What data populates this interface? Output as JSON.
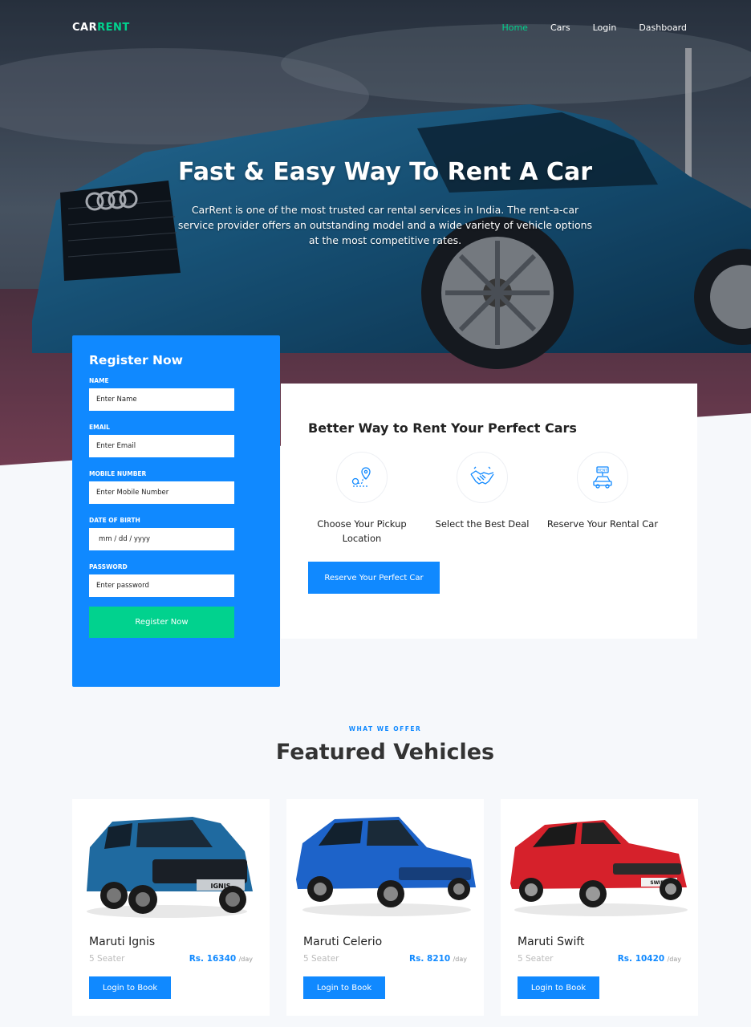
{
  "nav": {
    "logo_main": "CAR",
    "logo_accent": "RENT",
    "links": [
      "Home",
      "Cars",
      "Login",
      "Dashboard"
    ]
  },
  "hero": {
    "title": "Fast & Easy Way To Rent A Car",
    "text": "CarRent is one of the most trusted car rental services in India. The rent-a-car service provider offers an outstanding model and a wide variety of vehicle options at the most competitive rates."
  },
  "register": {
    "title": "Register Now",
    "fields": [
      {
        "label": "NAME",
        "placeholder": "Enter Name"
      },
      {
        "label": "EMAIL",
        "placeholder": "Enter Email"
      },
      {
        "label": "MOBILE NUMBER",
        "placeholder": "Enter Mobile Number"
      },
      {
        "label": "DATE OF BIRTH",
        "placeholder": "mm / dd / yyyy"
      },
      {
        "label": "PASSWORD",
        "placeholder": "Enter password"
      }
    ],
    "button": "Register Now"
  },
  "better": {
    "title": "Better Way to Rent Your Perfect Cars",
    "steps": [
      {
        "label": "Choose Your Pickup Location",
        "icon": "map-pin-route-icon"
      },
      {
        "label": "Select the Best Deal",
        "icon": "handshake-icon"
      },
      {
        "label": "Reserve Your Rental Car",
        "icon": "rent-car-icon"
      }
    ],
    "button": "Reserve Your Perfect Car"
  },
  "featured": {
    "kicker": "WHAT WE OFFER",
    "title": "Featured Vehicles",
    "cars": [
      {
        "name": "Maruti Ignis",
        "seats": "5 Seater",
        "price": "Rs. 16340",
        "per": "/day",
        "color": "#1f6aa0",
        "button": "Login to Book"
      },
      {
        "name": "Maruti Celerio",
        "seats": "5 Seater",
        "price": "Rs. 8210",
        "per": "/day",
        "color": "#1d63c9",
        "button": "Login to Book"
      },
      {
        "name": "Maruti Swift",
        "seats": "5 Seater",
        "price": "Rs. 10420",
        "per": "/day",
        "color": "#d6212b",
        "button": "Login to Book"
      }
    ]
  },
  "colors": {
    "primary": "#1089ff",
    "accent": "#01d28e"
  }
}
